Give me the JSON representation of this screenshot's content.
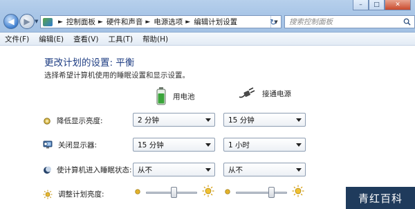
{
  "window": {
    "controls": [
      "–",
      "□",
      "✕"
    ]
  },
  "address": {
    "crumbs": [
      "控制面板",
      "硬件和声音",
      "电源选项",
      "编辑计划设置"
    ]
  },
  "search": {
    "placeholder": "搜索控制面板"
  },
  "menu": {
    "items": [
      "文件(F)",
      "编辑(E)",
      "查看(V)",
      "工具(T)",
      "帮助(H)"
    ]
  },
  "page": {
    "title": "更改计划的设置: 平衡",
    "subtitle": "选择希望计算机使用的睡眠设置和显示设置。"
  },
  "columns": {
    "battery": "用电池",
    "plugged": "接通电源"
  },
  "settings": [
    {
      "label": "降低显示亮度:",
      "battery": "2 分钟",
      "plugged": "15 分钟"
    },
    {
      "label": "关闭显示器:",
      "battery": "15 分钟",
      "plugged": "1 小时"
    },
    {
      "label": "使计算机进入睡眠状态:",
      "battery": "从不",
      "plugged": "从不"
    }
  ],
  "brightness": {
    "label": "调整计划亮度:",
    "battery_level_pct": 55,
    "plugged_level_pct": 72
  },
  "watermark": "青红百科",
  "colors": {
    "title_blue": "#1d3c82",
    "chrome_blue": "#a9c6e7"
  }
}
